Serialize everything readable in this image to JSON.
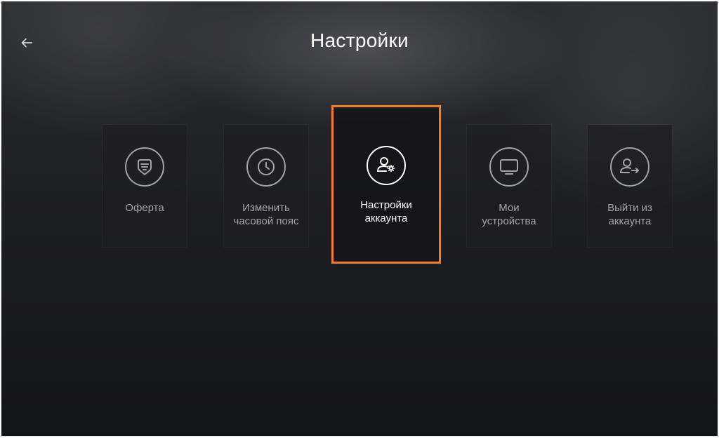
{
  "header": {
    "title": "Настройки",
    "back_icon": "arrow-left-icon"
  },
  "tiles": [
    {
      "line1": "Оферта",
      "line2": "",
      "icon": "document-list-icon",
      "selected": false
    },
    {
      "line1": "Изменить",
      "line2": "часовой пояс",
      "icon": "clock-icon",
      "selected": false
    },
    {
      "line1": "Настройки",
      "line2": "аккаунта",
      "icon": "user-settings-icon",
      "selected": true
    },
    {
      "line1": "Мои",
      "line2": "устройства",
      "icon": "monitor-icon",
      "selected": false
    },
    {
      "line1": "Выйти из",
      "line2": "аккаунта",
      "icon": "logout-icon",
      "selected": false
    }
  ],
  "colors": {
    "accent": "#f07c26",
    "inactive_text": "#a3a4a7",
    "active_text": "#ffffff"
  }
}
